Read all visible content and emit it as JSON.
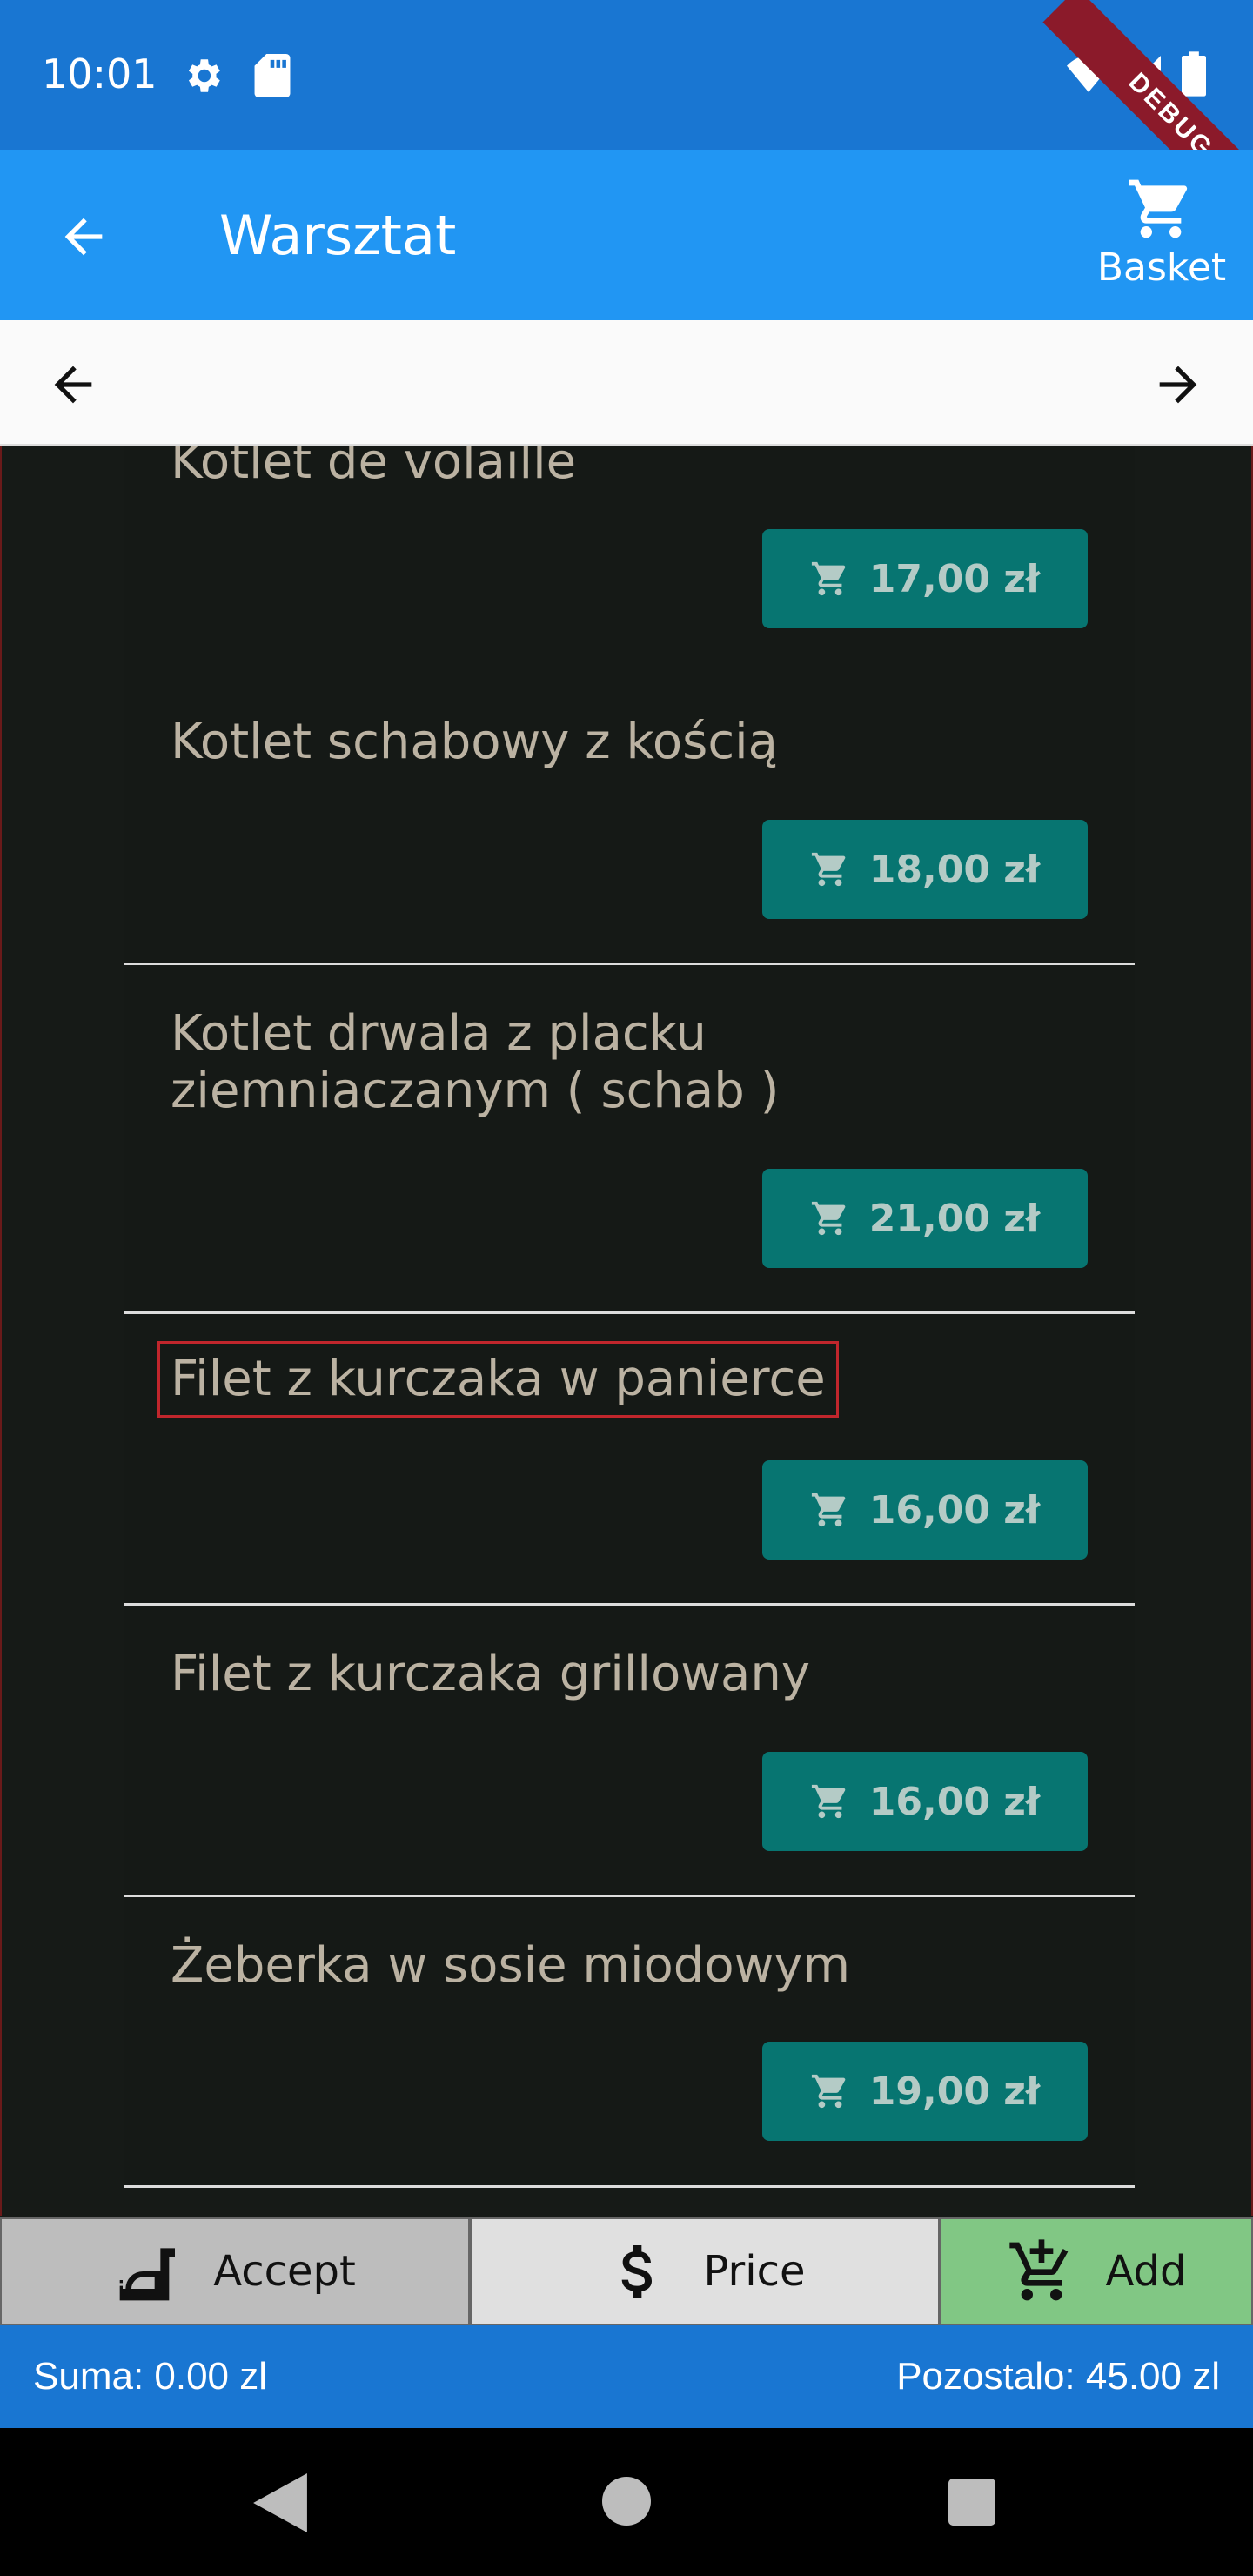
{
  "status_bar": {
    "time": "10:01",
    "debug_label": "DEBUG",
    "icons": [
      "gear-icon",
      "sd-card-icon",
      "wifi-icon",
      "signal-icon",
      "battery-icon"
    ]
  },
  "app_bar": {
    "title": "Warsztat",
    "basket_label": "Basket",
    "icons": [
      "back-arrow-icon",
      "cart-icon"
    ]
  },
  "nav_strip": {
    "icons": [
      "arrow-left-icon",
      "arrow-right-icon"
    ]
  },
  "menu": {
    "items": [
      {
        "name": "Kotlet de volaille",
        "price": "17,00 zł"
      },
      {
        "name": "Kotlet schabowy z kością",
        "price": "18,00 zł"
      },
      {
        "name": "Kotlet drwala z placku ziemniaczanym ( schab )",
        "price": "21,00 zł"
      },
      {
        "name": "Filet z kurczaka w panierce",
        "price": "16,00 zł"
      },
      {
        "name": "Filet z kurczaka grillowany",
        "price": "16,00 zł"
      },
      {
        "name": "Żeberka w sosie miodowym",
        "price": "19,00 zł"
      }
    ]
  },
  "actions": {
    "accept_label": "Accept",
    "price_label": "Price",
    "add_label": "Add"
  },
  "summary": {
    "sum": "Suma: 0.00 zl",
    "remaining": "Pozostalo: 45.00 zl"
  },
  "colors": {
    "status_bar": "#1976d2",
    "app_bar": "#2196f3",
    "price_button": "#077571",
    "add_button": "#81c784",
    "highlight": "#c0262c"
  }
}
